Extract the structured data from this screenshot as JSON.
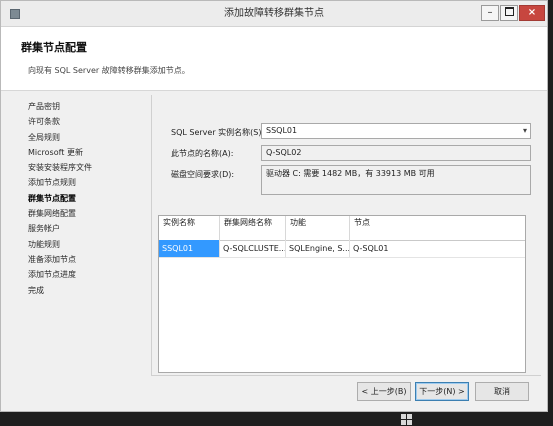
{
  "window": {
    "title": "添加故障转移群集节点",
    "controls": {
      "minimize": "–",
      "close": "×"
    }
  },
  "header": {
    "title": "群集节点配置",
    "subtitle": "向现有 SQL Server 故障转移群集添加节点。"
  },
  "nav": {
    "items": [
      {
        "label": "产品密钥",
        "active": false
      },
      {
        "label": "许可条款",
        "active": false
      },
      {
        "label": "全局规则",
        "active": false
      },
      {
        "label": "Microsoft 更新",
        "active": false
      },
      {
        "label": "安装安装程序文件",
        "active": false
      },
      {
        "label": "添加节点规则",
        "active": false
      },
      {
        "label": "群集节点配置",
        "active": true
      },
      {
        "label": "群集网络配置",
        "active": false
      },
      {
        "label": "服务帐户",
        "active": false
      },
      {
        "label": "功能规则",
        "active": false
      },
      {
        "label": "准备添加节点",
        "active": false
      },
      {
        "label": "添加节点进度",
        "active": false
      },
      {
        "label": "完成",
        "active": false
      }
    ]
  },
  "form": {
    "instance_label": "SQL Server 实例名称(S):",
    "instance_value": "SSQL01",
    "node_label": "此节点的名称(A):",
    "node_value": "Q-SQL02",
    "disk_label": "磁盘空间要求(D):",
    "disk_value": "驱动器 C: 需要 1482 MB，有 33913 MB 可用"
  },
  "grid": {
    "headers": [
      "实例名称",
      "群集网络名称",
      "功能",
      "节点"
    ],
    "rows": [
      [
        "SSQL01",
        "Q-SQLCLUSTE...",
        "SQLEngine, S...",
        "Q-SQL01"
      ]
    ]
  },
  "buttons": {
    "back": "< 上一步(B)",
    "next": "下一步(N) >",
    "cancel": "取消"
  },
  "icons": {
    "dropdown": "chevron-down-icon",
    "app": "setup-app-icon"
  }
}
